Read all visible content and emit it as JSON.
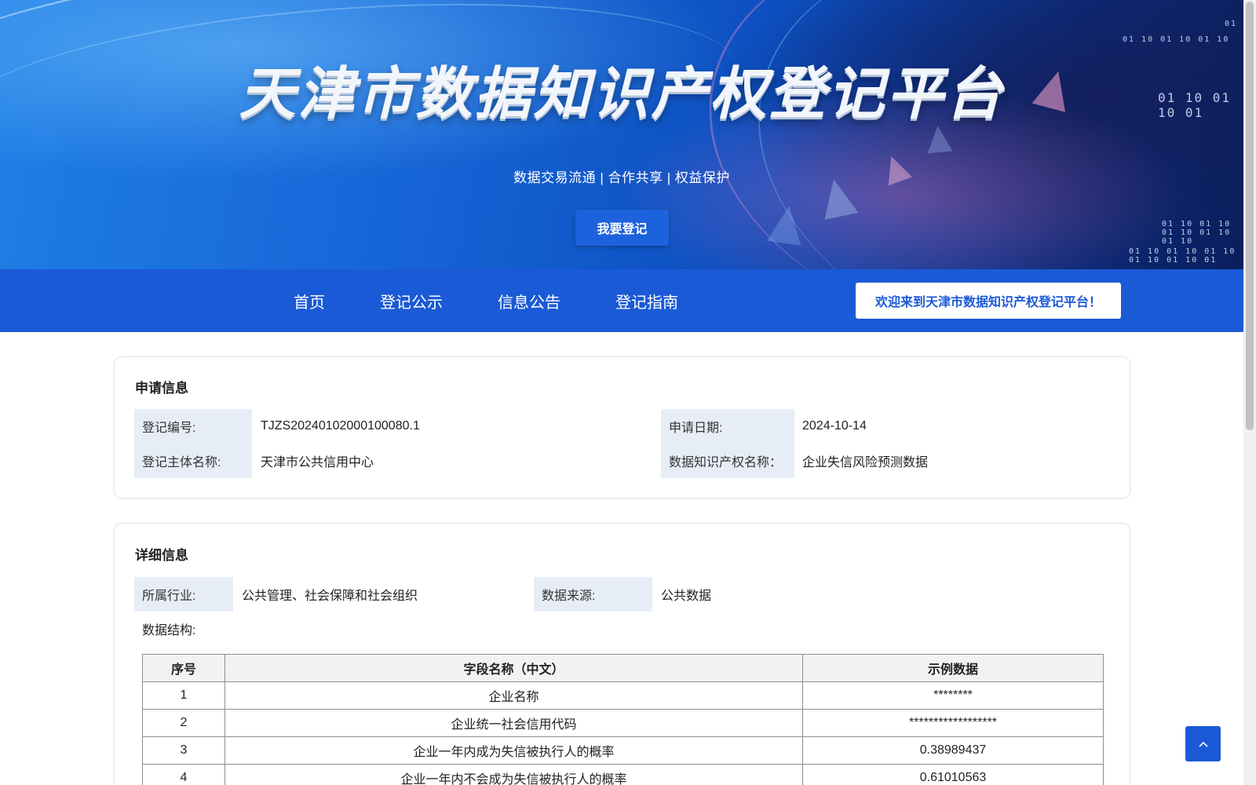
{
  "banner": {
    "title": "天津市数据知识产权登记平台",
    "subtitle": "数据交易流通 | 合作共享 | 权益保护",
    "register_button": "我要登记",
    "binary_texts": [
      "01 10 01 10 01 10",
      "01 10 01 10 01",
      "01 10 01 10 01 10 01 10 01 10",
      "01 10 01 10 01 10 01 10 01 10 01",
      "01"
    ]
  },
  "nav": {
    "items": [
      "首页",
      "登记公示",
      "信息公告",
      "登记指南"
    ],
    "welcome": "欢迎来到天津市数据知识产权登记平台！"
  },
  "application_info": {
    "title": "申请信息",
    "fields": [
      {
        "label": "登记编号:",
        "value": "TJZS20240102000100080.1"
      },
      {
        "label": "申请日期:",
        "value": "2024-10-14"
      },
      {
        "label": "登记主体名称:",
        "value": "天津市公共信用中心"
      },
      {
        "label": "数据知识产权名称：",
        "value": "企业失信风险预测数据"
      }
    ]
  },
  "detail_info": {
    "title": "详细信息",
    "industry_label": "所属行业:",
    "industry_value": "公共管理、社会保障和社会组织",
    "source_label": "数据来源:",
    "source_value": "公共数据",
    "structure_label": "数据结构:",
    "table": {
      "headers": [
        "序号",
        "字段名称（中文）",
        "示例数据"
      ],
      "rows": [
        [
          "1",
          "企业名称",
          "********"
        ],
        [
          "2",
          "企业统一社会信用代码",
          "******************"
        ],
        [
          "3",
          "企业一年内成为失信被执行人的概率",
          "0.38989437"
        ],
        [
          "4",
          "企业一年内不会成为失信被执行人的概率",
          "0.61010563"
        ]
      ]
    }
  },
  "colors": {
    "primary": "#1b5ad6",
    "label_bg": "#e7edf7"
  }
}
